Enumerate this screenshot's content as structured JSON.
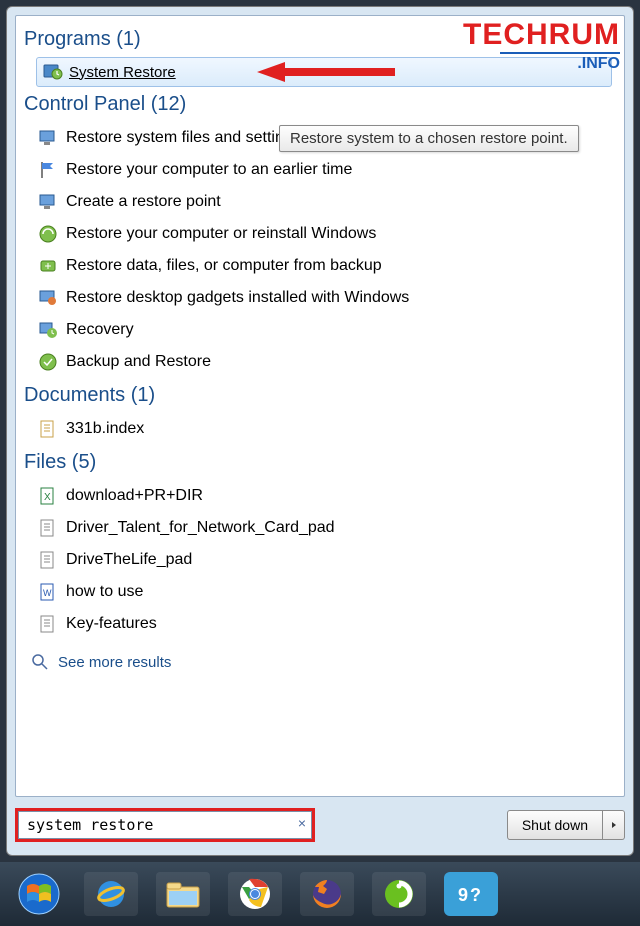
{
  "watermark": {
    "brand_top": "TECHRUM",
    "brand_sub": ".INFO"
  },
  "sections": {
    "programs": {
      "header": "Programs (1)",
      "item": "System Restore"
    },
    "control_panel": {
      "header": "Control Panel (12)",
      "items": [
        "Restore system files and settings from a restore point",
        "Restore your computer to an earlier time",
        "Create a restore point",
        "Restore your computer or reinstall Windows",
        "Restore data, files, or computer from backup",
        "Restore desktop gadgets installed with Windows",
        "Recovery",
        "Backup and Restore"
      ]
    },
    "documents": {
      "header": "Documents (1)",
      "items": [
        "331b.index"
      ]
    },
    "files": {
      "header": "Files (5)",
      "items": [
        "download+PR+DIR",
        "Driver_Talent_for_Network_Card_pad",
        "DriveTheLife_pad",
        "how to use",
        "Key-features"
      ]
    }
  },
  "tooltip": "Restore system to a chosen restore point.",
  "see_more": "See more results",
  "search": {
    "value": "system restore",
    "clear": "×"
  },
  "shutdown": {
    "label": "Shut down"
  }
}
